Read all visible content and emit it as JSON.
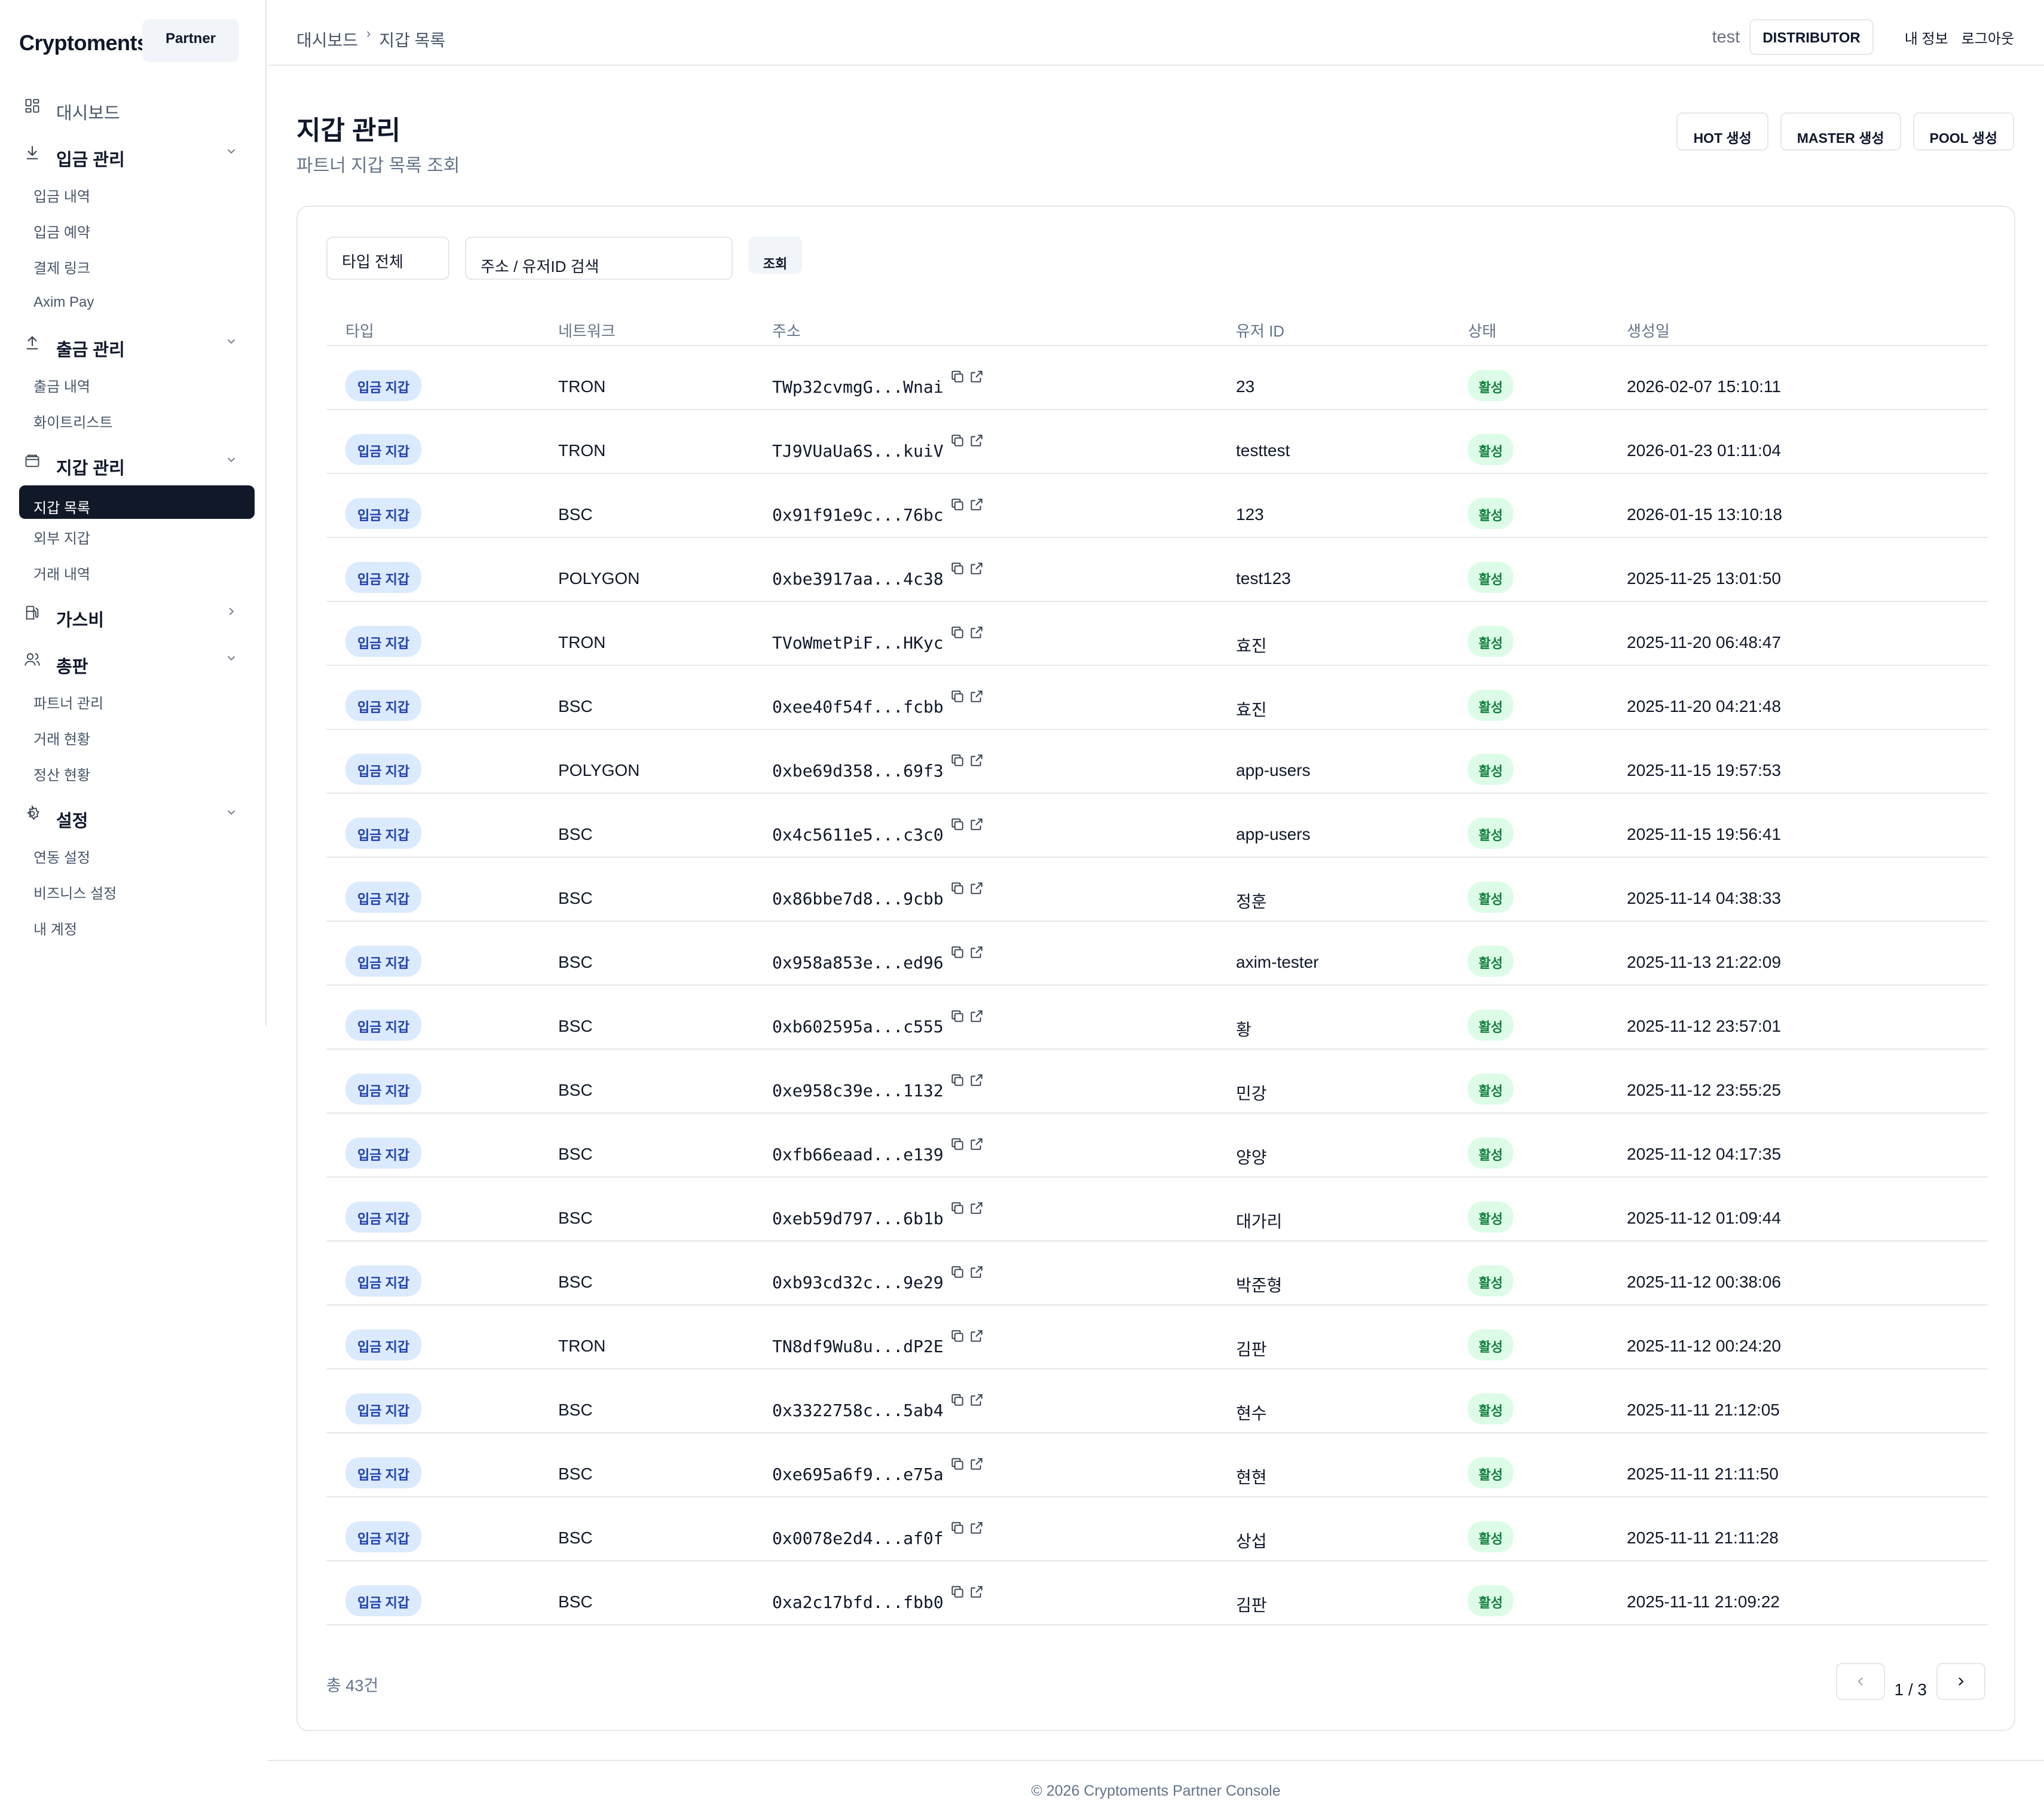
{
  "brand": {
    "name": "Cryptoments",
    "badge": "Partner"
  },
  "sidebar": {
    "dashboard": "대시보드",
    "deposit": {
      "label": "입금 관리",
      "items": [
        "입금 내역",
        "입금 예약",
        "결제 링크",
        "Axim Pay"
      ]
    },
    "withdraw": {
      "label": "출금 관리",
      "items": [
        "출금 내역",
        "화이트리스트"
      ]
    },
    "wallet": {
      "label": "지갑 관리",
      "items": [
        "지갑 목록",
        "외부 지갑",
        "거래 내역"
      ]
    },
    "gas": {
      "label": "가스비"
    },
    "distributor": {
      "label": "총판",
      "items": [
        "파트너 관리",
        "거래 현황",
        "정산 현황"
      ]
    },
    "settings": {
      "label": "설정",
      "items": [
        "연동 설정",
        "비즈니스 설정",
        "내 계정"
      ]
    }
  },
  "header": {
    "breadcrumb": [
      "대시보드",
      "지갑 목록"
    ],
    "user": "test",
    "role": "DISTRIBUTOR",
    "my_info": "내 정보",
    "logout": "로그아웃"
  },
  "page": {
    "title": "지갑 관리",
    "subtitle": "파트너 지갑 목록 조회",
    "actions": [
      "HOT 생성",
      "MASTER 생성",
      "POOL 생성"
    ]
  },
  "filters": {
    "type_select": "타입 전체",
    "search_placeholder": "주소 / 유저ID 검색",
    "search_button": "조회"
  },
  "table": {
    "columns": [
      "타입",
      "네트워크",
      "주소",
      "유저 ID",
      "상태",
      "생성일"
    ],
    "rows": [
      {
        "type": "입금 지갑",
        "network": "TRON",
        "address": "TWp32cvmgG...Wnai",
        "user": "23",
        "status": "활성",
        "created": "2026-02-07 15:10:11"
      },
      {
        "type": "입금 지갑",
        "network": "TRON",
        "address": "TJ9VUaUa6S...kuiV",
        "user": "testtest",
        "status": "활성",
        "created": "2026-01-23 01:11:04"
      },
      {
        "type": "입금 지갑",
        "network": "BSC",
        "address": "0x91f91e9c...76bc",
        "user": "123",
        "status": "활성",
        "created": "2026-01-15 13:10:18"
      },
      {
        "type": "입금 지갑",
        "network": "POLYGON",
        "address": "0xbe3917aa...4c38",
        "user": "test123",
        "status": "활성",
        "created": "2025-11-25 13:01:50"
      },
      {
        "type": "입금 지갑",
        "network": "TRON",
        "address": "TVoWmetPiF...HKyc",
        "user": "효진",
        "status": "활성",
        "created": "2025-11-20 06:48:47"
      },
      {
        "type": "입금 지갑",
        "network": "BSC",
        "address": "0xee40f54f...fcbb",
        "user": "효진",
        "status": "활성",
        "created": "2025-11-20 04:21:48"
      },
      {
        "type": "입금 지갑",
        "network": "POLYGON",
        "address": "0xbe69d358...69f3",
        "user": "app-users",
        "status": "활성",
        "created": "2025-11-15 19:57:53"
      },
      {
        "type": "입금 지갑",
        "network": "BSC",
        "address": "0x4c5611e5...c3c0",
        "user": "app-users",
        "status": "활성",
        "created": "2025-11-15 19:56:41"
      },
      {
        "type": "입금 지갑",
        "network": "BSC",
        "address": "0x86bbe7d8...9cbb",
        "user": "정훈",
        "status": "활성",
        "created": "2025-11-14 04:38:33"
      },
      {
        "type": "입금 지갑",
        "network": "BSC",
        "address": "0x958a853e...ed96",
        "user": "axim-tester",
        "status": "활성",
        "created": "2025-11-13 21:22:09"
      },
      {
        "type": "입금 지갑",
        "network": "BSC",
        "address": "0xb602595a...c555",
        "user": "황",
        "status": "활성",
        "created": "2025-11-12 23:57:01"
      },
      {
        "type": "입금 지갑",
        "network": "BSC",
        "address": "0xe958c39e...1132",
        "user": "민강",
        "status": "활성",
        "created": "2025-11-12 23:55:25"
      },
      {
        "type": "입금 지갑",
        "network": "BSC",
        "address": "0xfb66eaad...e139",
        "user": "양양",
        "status": "활성",
        "created": "2025-11-12 04:17:35"
      },
      {
        "type": "입금 지갑",
        "network": "BSC",
        "address": "0xeb59d797...6b1b",
        "user": "대가리",
        "status": "활성",
        "created": "2025-11-12 01:09:44"
      },
      {
        "type": "입금 지갑",
        "network": "BSC",
        "address": "0xb93cd32c...9e29",
        "user": "박준형",
        "status": "활성",
        "created": "2025-11-12 00:38:06"
      },
      {
        "type": "입금 지갑",
        "network": "TRON",
        "address": "TN8df9Wu8u...dP2E",
        "user": "김판",
        "status": "활성",
        "created": "2025-11-12 00:24:20"
      },
      {
        "type": "입금 지갑",
        "network": "BSC",
        "address": "0x3322758c...5ab4",
        "user": "현수",
        "status": "활성",
        "created": "2025-11-11 21:12:05"
      },
      {
        "type": "입금 지갑",
        "network": "BSC",
        "address": "0xe695a6f9...e75a",
        "user": "현현",
        "status": "활성",
        "created": "2025-11-11 21:11:50"
      },
      {
        "type": "입금 지갑",
        "network": "BSC",
        "address": "0x0078e2d4...af0f",
        "user": "상섭",
        "status": "활성",
        "created": "2025-11-11 21:11:28"
      },
      {
        "type": "입금 지갑",
        "network": "BSC",
        "address": "0xa2c17bfd...fbb0",
        "user": "김판",
        "status": "활성",
        "created": "2025-11-11 21:09:22"
      }
    ]
  },
  "pagination": {
    "total": "총 43건",
    "page": "1 / 3"
  },
  "footer": "© 2026 Cryptoments Partner Console",
  "colors": {
    "active_nav_bg": "#111827",
    "type_pill_bg": "#dbeafe",
    "status_pill_bg": "#dcfce7"
  }
}
